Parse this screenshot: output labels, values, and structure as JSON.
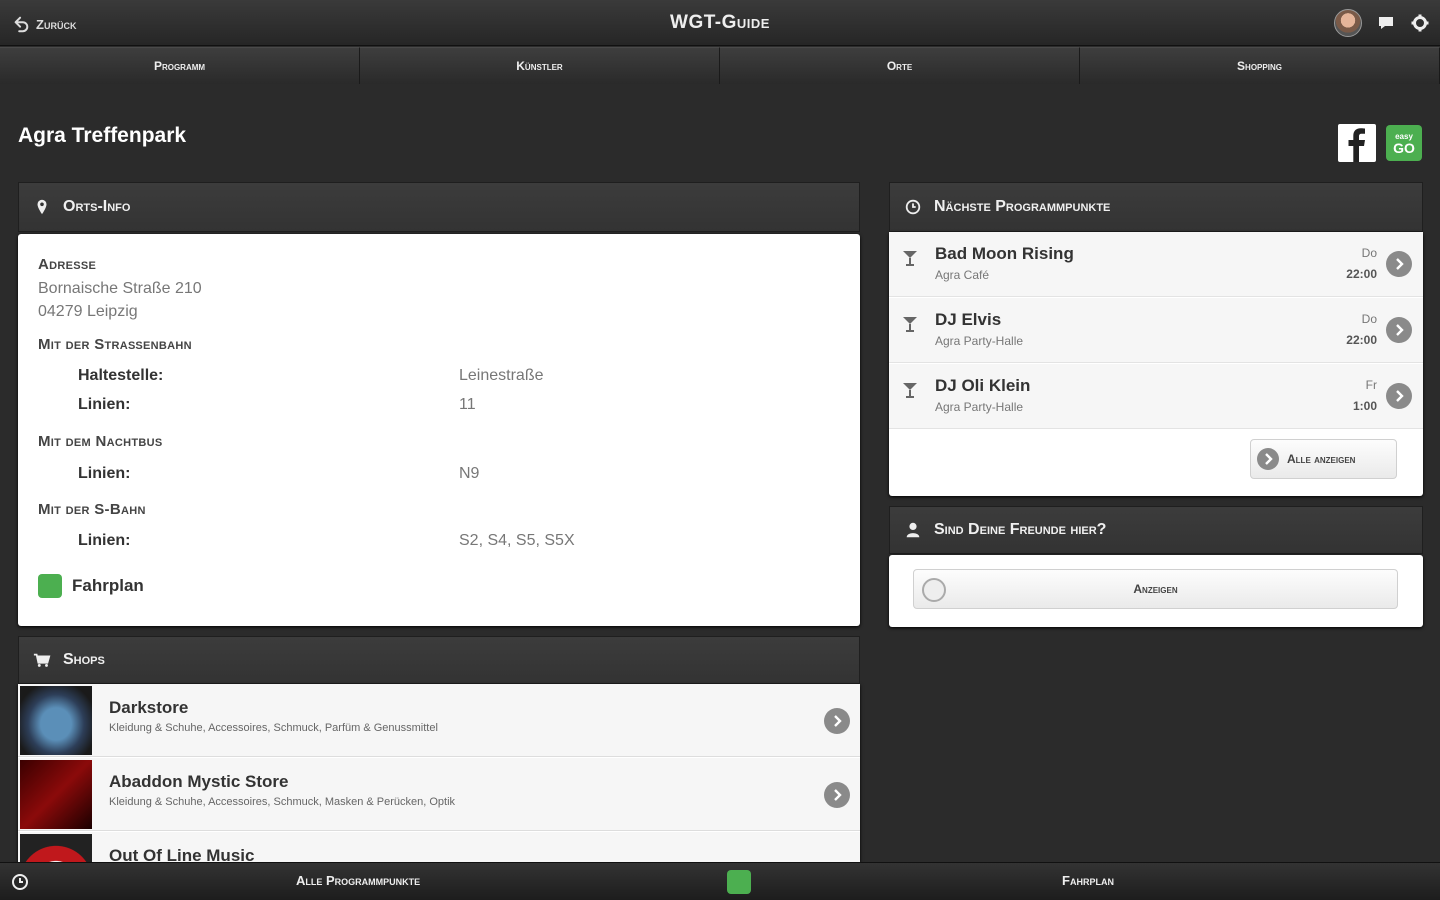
{
  "header": {
    "back_label": "Zurück",
    "title": "WGT-Guide"
  },
  "nav": {
    "tabs": [
      "Programm",
      "Künstler",
      "Orte",
      "Shopping"
    ]
  },
  "page": {
    "title": "Agra Treffenpark",
    "easygo_label": "easy GO"
  },
  "orts_info": {
    "heading": "Orts-Info",
    "address_label": "Adresse",
    "address_line1": "Bornaische Straße 210",
    "address_line2": "04279 Leipzig",
    "tram_label": "Mit der Straßenbahn",
    "tram_stop_key": "Haltestelle:",
    "tram_stop_val": "Leinestraße",
    "tram_lines_key": "Linien:",
    "tram_lines_val": "11",
    "nightbus_label": "Mit dem Nachtbus",
    "nightbus_lines_key": "Linien:",
    "nightbus_lines_val": "N9",
    "sbahn_label": "Mit der S-Bahn",
    "sbahn_lines_key": "Linien:",
    "sbahn_lines_val": "S2, S4, S5, S5X",
    "fahrplan_label": "Fahrplan"
  },
  "shops": {
    "heading": "Shops",
    "items": [
      {
        "name": "Darkstore",
        "desc": "Kleidung & Schuhe, Accessoires, Schmuck, Parfüm & Genussmittel"
      },
      {
        "name": "Abaddon Mystic Store",
        "desc": "Kleidung & Schuhe, Accessoires, Schmuck, Masken & Perücken, Optik"
      },
      {
        "name": "Out Of Line Music",
        "desc": ""
      }
    ]
  },
  "program": {
    "heading": "Nächste Programmpunkte",
    "items": [
      {
        "name": "Bad Moon Rising",
        "location": "Agra Café",
        "day": "Do",
        "time": "22:00"
      },
      {
        "name": "DJ Elvis",
        "location": "Agra Party-Halle",
        "day": "Do",
        "time": "22:00"
      },
      {
        "name": "DJ Oli Klein",
        "location": "Agra Party-Halle",
        "day": "Fr",
        "time": "1:00"
      }
    ],
    "show_all_label": "Alle anzeigen"
  },
  "friends": {
    "heading": "Sind Deine Freunde hier?",
    "show_label": "Anzeigen"
  },
  "bottom": {
    "all_program_label": "Alle Programmpunkte",
    "fahrplan_label": "Fahrplan"
  },
  "colors": {
    "accent_green": "#4caf50",
    "background": "#2b2b2b",
    "facebook": "#ffffff"
  }
}
